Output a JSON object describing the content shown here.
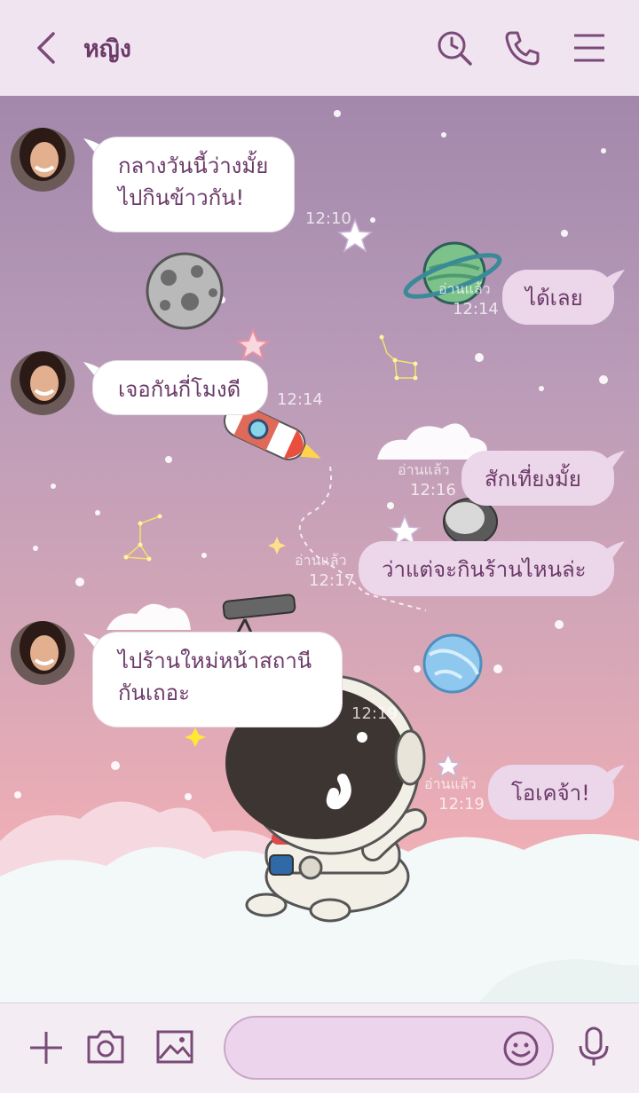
{
  "header": {
    "title": "หญิง",
    "icons": [
      "back-arrow-icon",
      "search-history-icon",
      "phone-icon",
      "menu-icon"
    ]
  },
  "messages": [
    {
      "from": "contact",
      "lines": [
        "กลางวันนี้ว่างมั้ย",
        "ไปกินข้าวกัน!"
      ],
      "time": "12:10"
    },
    {
      "from": "me",
      "lines": [
        "ได้เลย"
      ],
      "read": "อ่านแล้ว",
      "time": "12:14"
    },
    {
      "from": "contact",
      "lines": [
        "เจอกันกี่โมงดี"
      ],
      "time": "12:14"
    },
    {
      "from": "me",
      "lines": [
        "สักเที่ยงมั้ย"
      ],
      "read": "อ่านแล้ว",
      "time": "12:16"
    },
    {
      "from": "me",
      "lines": [
        "ว่าแต่จะกินร้านไหนล่ะ"
      ],
      "read": "อ่านแล้ว",
      "time": "12:17"
    },
    {
      "from": "contact",
      "lines": [
        "ไปร้านใหม่หน้าสถานี",
        "กันเถอะ"
      ],
      "time": "12:19"
    },
    {
      "from": "me",
      "lines": [
        "โอเคจ้า!"
      ],
      "read": "อ่านแล้ว",
      "time": "12:19"
    }
  ],
  "footer": {
    "icons": [
      "plus-icon",
      "camera-icon",
      "image-icon",
      "emoji-icon",
      "microphone-icon"
    ],
    "input_placeholder": "",
    "input_value": ""
  },
  "colors": {
    "header_bg": "#f1e4f1",
    "accent": "#7a4a78",
    "outgoing_bubble": "#ecd6ea",
    "incoming_bubble": "#ffffff"
  }
}
